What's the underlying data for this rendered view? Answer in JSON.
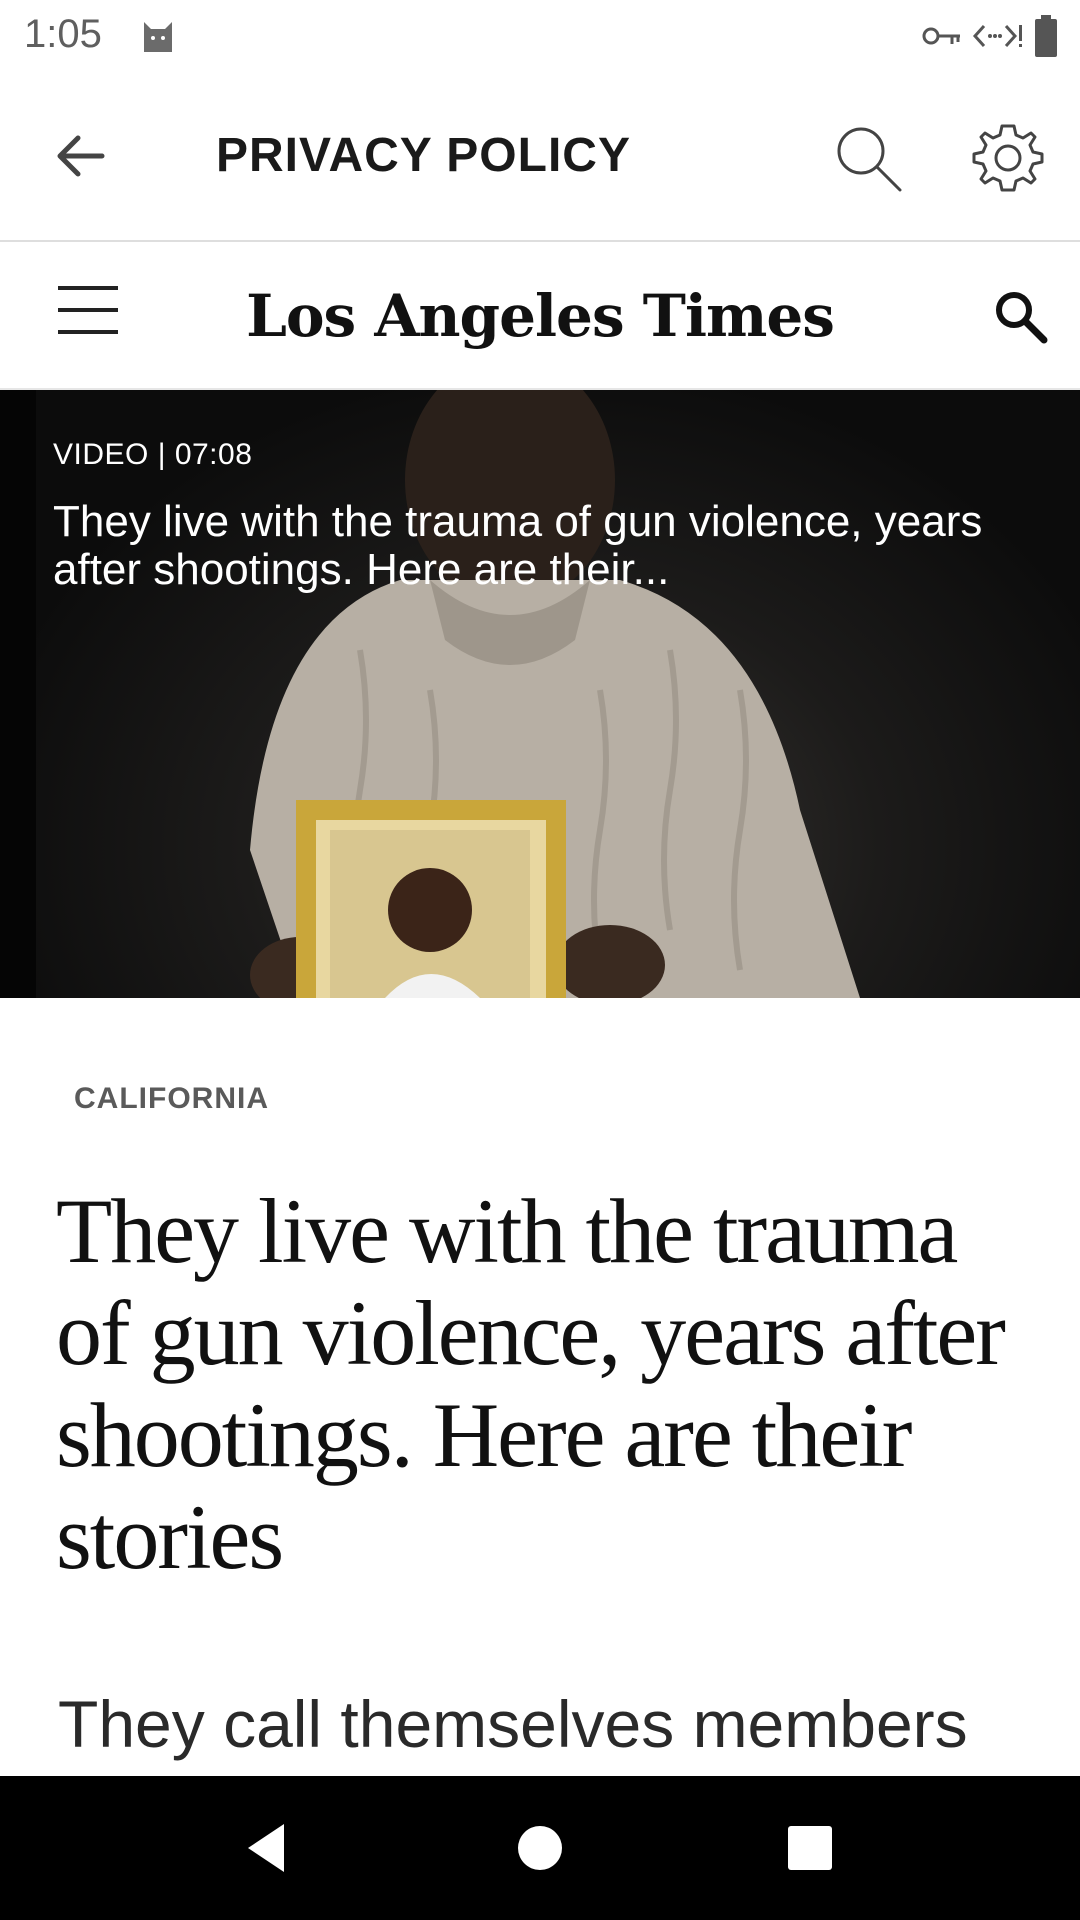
{
  "status_bar": {
    "time": "1:05",
    "icons": [
      "cat-icon",
      "key-icon",
      "data-arrows-icon",
      "battery-icon"
    ]
  },
  "toolbar": {
    "title": "PRIVACY POLICY",
    "icons": [
      "back-arrow-icon",
      "search-icon",
      "settings-gear-icon"
    ]
  },
  "site": {
    "logo": "Los Angeles Times",
    "icons": [
      "hamburger-menu-icon",
      "search-icon"
    ]
  },
  "hero": {
    "meta": "VIDEO | 07:08",
    "title": "They live with the trauma of gun violence, years after shootings. Here are their..."
  },
  "article": {
    "section": "CALIFORNIA",
    "headline": "They live with the trauma of gun violence, years after shootings. Here are their stories",
    "lede": "They call themselves members"
  },
  "nav_bar": {
    "icons": [
      "nav-back-icon",
      "nav-home-icon",
      "nav-recents-icon"
    ]
  },
  "colors": {
    "background": "#ffffff",
    "text_dark": "#111111",
    "label_gray": "#5a5a5a",
    "nav_bar": "#000000"
  }
}
